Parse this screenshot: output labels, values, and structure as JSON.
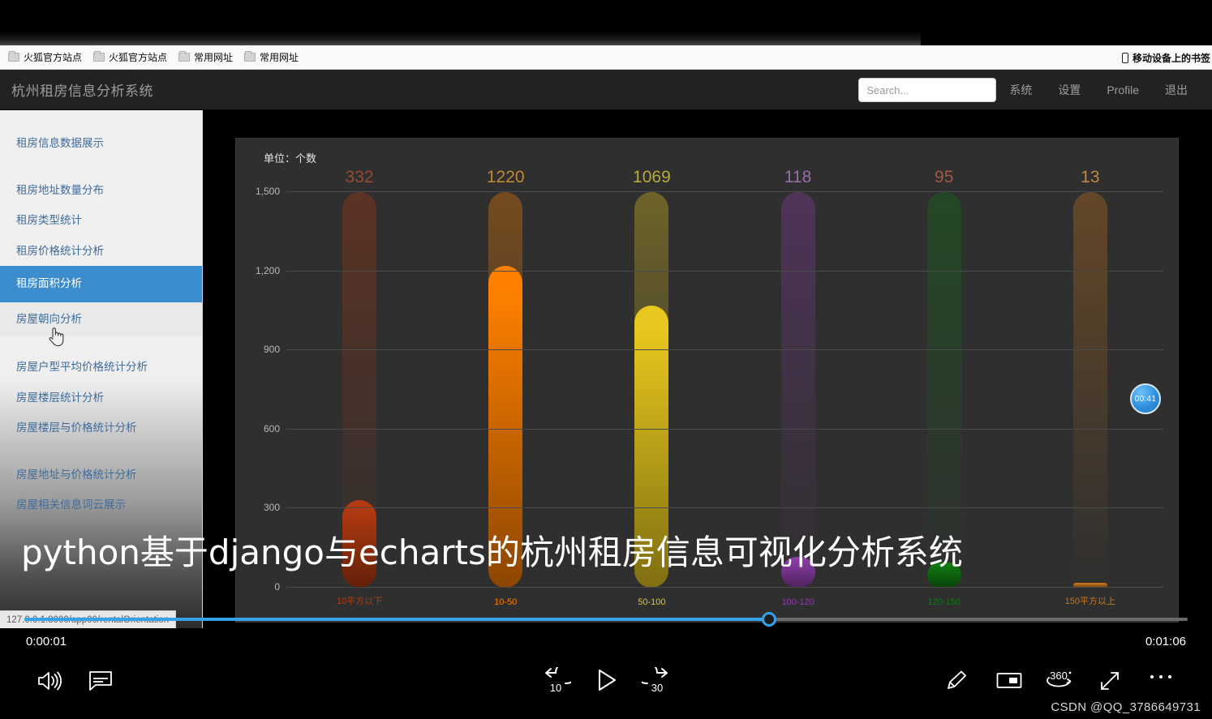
{
  "browser": {
    "bookmarks": [
      {
        "label": "火狐官方站点",
        "icon": "folder-icon"
      },
      {
        "label": "火狐官方站点",
        "icon": "folder-icon"
      },
      {
        "label": "常用网址",
        "icon": "folder-icon"
      },
      {
        "label": "常用网址",
        "icon": "folder-icon"
      }
    ],
    "mobile_bookmarks": "移动设备上的书签",
    "status_url": "127.0.0.1:8000/app00/rentalOrientation"
  },
  "app": {
    "brand": "杭州租房信息分析系统",
    "search": {
      "placeholder": "Search...",
      "value": ""
    },
    "nav": [
      {
        "label": "系统"
      },
      {
        "label": "设置"
      },
      {
        "label": "Profile"
      },
      {
        "label": "退出"
      }
    ]
  },
  "sidebar": {
    "items": [
      {
        "label": "租房信息数据展示",
        "state": "normal"
      },
      {
        "label": "租房地址数量分布",
        "state": "gap"
      },
      {
        "label": "租房类型统计",
        "state": "normal"
      },
      {
        "label": "租房价格统计分析",
        "state": "normal"
      },
      {
        "label": "租房面积分析",
        "state": "active"
      },
      {
        "label": "房屋朝向分析",
        "state": "hover"
      },
      {
        "label": "房屋户型平均价格统计分析",
        "state": "gap"
      },
      {
        "label": "房屋楼层统计分析",
        "state": "normal"
      },
      {
        "label": "房屋楼层与价格统计分析",
        "state": "normal"
      },
      {
        "label": "房屋地址与价格统计分析",
        "state": "gap"
      },
      {
        "label": "房屋相关信息词云展示",
        "state": "normal"
      }
    ]
  },
  "chart_data": {
    "type": "bar",
    "title": "",
    "unit_label": "单位：个数",
    "xlabel": "",
    "ylabel": "",
    "ylim": [
      0,
      1500
    ],
    "grid": true,
    "yticks": [
      0,
      300,
      600,
      900,
      1200,
      1500
    ],
    "ytick_labels": [
      "0",
      "300",
      "600",
      "900",
      "1,200",
      "1,500"
    ],
    "categories": [
      "10平方以下",
      "10-50",
      "50-100",
      "100-120",
      "120-150",
      "150平方以上"
    ],
    "values": [
      332,
      1220,
      1069,
      118,
      95,
      13
    ],
    "bar_colors": [
      "#b33a10",
      "#ff8000",
      "#e8c81e",
      "#8d3da8",
      "#0f7a12",
      "#c9761a"
    ],
    "label_colors": [
      "#9a4a32",
      "#c08a35",
      "#b8aa3a",
      "#9b6ca8",
      "#a05a45",
      "#c08a45"
    ],
    "background": "#2f2f2f",
    "track_background": true
  },
  "video": {
    "current_time": "0:00:01",
    "total_time": "0:01:06",
    "progress_percent": 64,
    "time_bubble": "00:41",
    "overlay_title": "python基于django与echarts的杭州租房信息可视化分析系统",
    "watermark": "CSDN @QQ_3786649731",
    "controls": [
      {
        "name": "volume-icon",
        "label": "音量"
      },
      {
        "name": "captions-icon",
        "label": "字幕"
      },
      {
        "name": "rewind-10-icon",
        "label": "10"
      },
      {
        "name": "play-icon",
        "label": "播放"
      },
      {
        "name": "forward-30-icon",
        "label": "30"
      },
      {
        "name": "pen-icon",
        "label": "绘制"
      },
      {
        "name": "mini-player-icon",
        "label": "小窗"
      },
      {
        "name": "360-icon",
        "label": "360"
      },
      {
        "name": "fullscreen-icon",
        "label": "全屏"
      },
      {
        "name": "more-options-icon",
        "label": "更多"
      }
    ]
  },
  "colors": {
    "accent": "#34a2e8",
    "sidebar_active": "#3c8dcd",
    "header_bg": "#222222",
    "chart_bg": "#2f2f2f"
  }
}
